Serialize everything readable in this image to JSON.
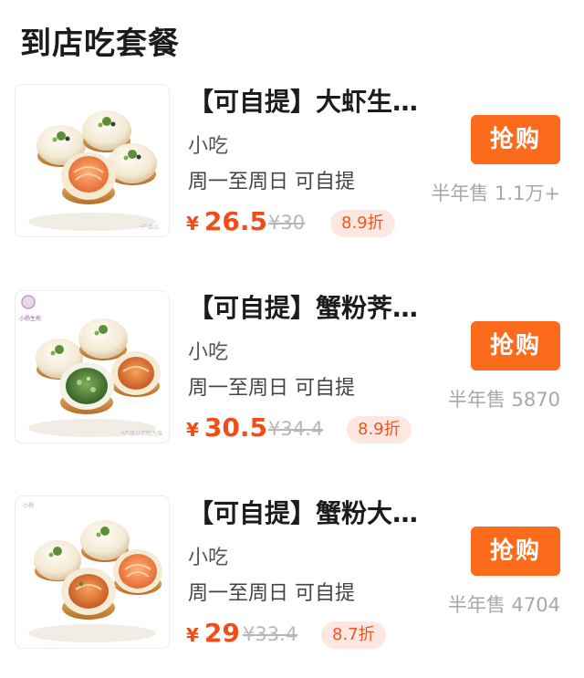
{
  "section_title": "到店吃套餐",
  "items": [
    {
      "name": "【可自提】大虾生…",
      "category": "小吃",
      "tags": "周一至周日  可自提",
      "currency": "¥",
      "price": "26.5",
      "original_price": "¥30",
      "discount": "8.9折",
      "buy_label": "抢购",
      "sold": "半年售 1.1万+",
      "thumb_icon": "shengjian-bun-shrimp-icon"
    },
    {
      "name": "【可自提】蟹粉荠…",
      "category": "小吃",
      "tags": "周一至周日  可自提",
      "currency": "¥",
      "price": "30.5",
      "original_price": "¥34.4",
      "discount": "8.9折",
      "buy_label": "抢购",
      "sold": "半年售 5870",
      "thumb_icon": "shengjian-bun-crab-shepherd-purse-icon"
    },
    {
      "name": "【可自提】蟹粉大…",
      "category": "小吃",
      "tags": "周一至周日  可自提",
      "currency": "¥",
      "price": "29",
      "original_price": "¥33.4",
      "discount": "8.7折",
      "buy_label": "抢购",
      "sold": "半年售 4704",
      "thumb_icon": "shengjian-bun-crab-shrimp-icon"
    }
  ],
  "colors": {
    "accent": "#fb6b1b",
    "price": "#f24d18",
    "discount_bg": "#fde8e1"
  }
}
